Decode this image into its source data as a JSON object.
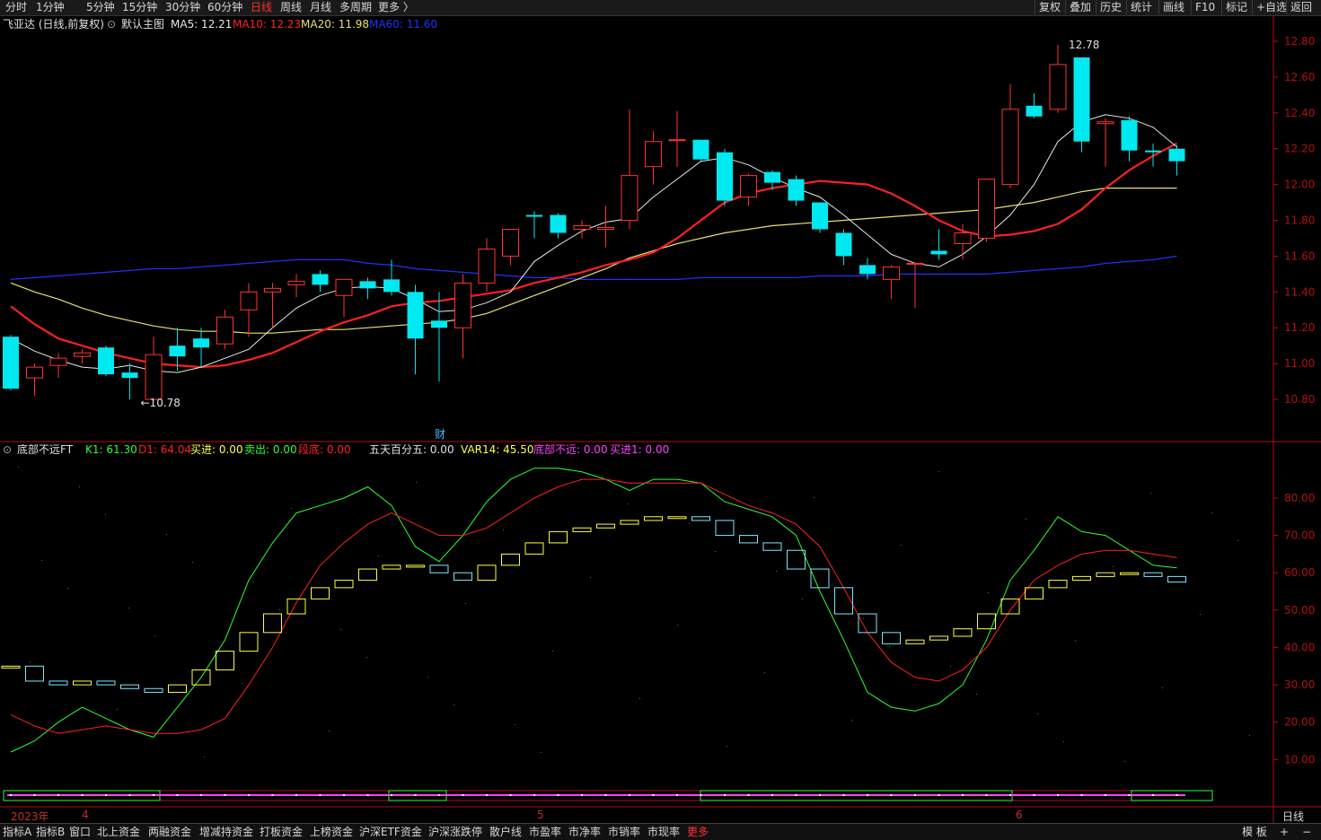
{
  "topbar": {
    "periods": [
      "分时",
      "1分钟",
      "5分钟",
      "15分钟",
      "30分钟",
      "60分钟",
      "日线",
      "周线",
      "月线",
      "多周期",
      "更多 〉"
    ],
    "active_period": "日线",
    "right_buttons": [
      "复权",
      "叠加",
      "历史",
      "统计",
      "画线",
      "F10",
      "标记",
      "+自选",
      "返回"
    ]
  },
  "main_legend": {
    "stock": "飞亚达 (日线,前复权)",
    "template": "默认主图",
    "ma5": "MA5: 12.21",
    "ma10": "MA10: 12.23",
    "ma20": "MA20: 11.98",
    "ma60": "MA60: 11.60"
  },
  "sub_legend": {
    "name": "底部不远FT",
    "k1": "K1: 61.30",
    "d1": "D1: 64.04",
    "buy": "买进: 0.00",
    "sell": "卖出: 0.00",
    "bottom": "段底: 0.00",
    "five_day": "五天百分五: 0.00",
    "var14": "VAR14: 45.50",
    "bottom_near": "底部不远: 0.00",
    "buy1": "买进1: 0.00"
  },
  "colors": {
    "up": "#ff3333",
    "down": "#00e8f0",
    "ma5": "#e8e8e8",
    "ma10": "#ff2020",
    "ma20": "#e8e070",
    "ma60": "#2030ff",
    "k1": "#30ff30",
    "d1": "#ff2020",
    "yellow": "#ffff40",
    "magenta": "#ff40ff",
    "axis": "#b01010"
  },
  "price_axis": {
    "labels": [
      "12.80",
      "12.60",
      "12.40",
      "12.20",
      "12.00",
      "11.80",
      "11.60",
      "11.40",
      "11.20",
      "11.00",
      "10.80"
    ]
  },
  "indicator_axis": {
    "labels": [
      "80.00",
      "70.00",
      "60.00",
      "50.00",
      "40.00",
      "30.00",
      "20.00",
      "10.00"
    ]
  },
  "annotations": {
    "high": "12.78",
    "low": "10.78",
    "marker": "财"
  },
  "dates": {
    "year_label": "2023年",
    "month4": "4",
    "month5": "5",
    "month6": "6",
    "period": "日线"
  },
  "chart_data": {
    "type": "candlestick",
    "ylim": [
      10.7,
      12.85
    ],
    "candles": [
      {
        "o": 11.15,
        "h": 11.16,
        "l": 10.85,
        "c": 10.86
      },
      {
        "o": 10.92,
        "h": 11.0,
        "l": 10.82,
        "c": 10.98
      },
      {
        "o": 10.99,
        "h": 11.06,
        "l": 10.92,
        "c": 11.03
      },
      {
        "o": 11.04,
        "h": 11.08,
        "l": 11.0,
        "c": 11.06
      },
      {
        "o": 11.09,
        "h": 11.1,
        "l": 10.93,
        "c": 10.94
      },
      {
        "o": 10.95,
        "h": 11.0,
        "l": 10.8,
        "c": 10.92
      },
      {
        "o": 10.8,
        "h": 11.15,
        "l": 10.79,
        "c": 11.05
      },
      {
        "o": 11.1,
        "h": 11.2,
        "l": 10.96,
        "c": 11.04
      },
      {
        "o": 11.14,
        "h": 11.2,
        "l": 10.98,
        "c": 11.09
      },
      {
        "o": 11.11,
        "h": 11.3,
        "l": 11.08,
        "c": 11.26
      },
      {
        "o": 11.3,
        "h": 11.45,
        "l": 11.15,
        "c": 11.4
      },
      {
        "o": 11.4,
        "h": 11.45,
        "l": 11.2,
        "c": 11.42
      },
      {
        "o": 11.44,
        "h": 11.5,
        "l": 11.37,
        "c": 11.46
      },
      {
        "o": 11.5,
        "h": 11.52,
        "l": 11.4,
        "c": 11.44
      },
      {
        "o": 11.38,
        "h": 11.47,
        "l": 11.26,
        "c": 11.47
      },
      {
        "o": 11.46,
        "h": 11.48,
        "l": 11.36,
        "c": 11.42
      },
      {
        "o": 11.47,
        "h": 11.58,
        "l": 11.38,
        "c": 11.4
      },
      {
        "o": 11.4,
        "h": 11.44,
        "l": 10.94,
        "c": 11.14
      },
      {
        "o": 11.24,
        "h": 11.4,
        "l": 10.9,
        "c": 11.2
      },
      {
        "o": 11.2,
        "h": 11.5,
        "l": 11.03,
        "c": 11.45
      },
      {
        "o": 11.45,
        "h": 11.7,
        "l": 11.4,
        "c": 11.64
      },
      {
        "o": 11.6,
        "h": 11.75,
        "l": 11.55,
        "c": 11.75
      },
      {
        "o": 11.83,
        "h": 11.85,
        "l": 11.7,
        "c": 11.82
      },
      {
        "o": 11.83,
        "h": 11.84,
        "l": 11.7,
        "c": 11.73
      },
      {
        "o": 11.75,
        "h": 11.8,
        "l": 11.7,
        "c": 11.77
      },
      {
        "o": 11.75,
        "h": 11.88,
        "l": 11.65,
        "c": 11.76
      },
      {
        "o": 11.8,
        "h": 12.42,
        "l": 11.75,
        "c": 12.05
      },
      {
        "o": 12.1,
        "h": 12.3,
        "l": 12.0,
        "c": 12.24
      },
      {
        "o": 12.25,
        "h": 12.41,
        "l": 12.1,
        "c": 12.25
      },
      {
        "o": 12.25,
        "h": 12.25,
        "l": 12.13,
        "c": 12.14
      },
      {
        "o": 12.18,
        "h": 12.2,
        "l": 11.88,
        "c": 11.91
      },
      {
        "o": 11.93,
        "h": 12.06,
        "l": 11.88,
        "c": 12.05
      },
      {
        "o": 12.07,
        "h": 12.08,
        "l": 11.97,
        "c": 12.01
      },
      {
        "o": 12.03,
        "h": 12.05,
        "l": 11.88,
        "c": 11.91
      },
      {
        "o": 11.9,
        "h": 11.9,
        "l": 11.73,
        "c": 11.75
      },
      {
        "o": 11.73,
        "h": 11.75,
        "l": 11.55,
        "c": 11.6
      },
      {
        "o": 11.55,
        "h": 11.59,
        "l": 11.47,
        "c": 11.5
      },
      {
        "o": 11.47,
        "h": 11.55,
        "l": 11.36,
        "c": 11.54
      },
      {
        "o": 11.56,
        "h": 11.56,
        "l": 11.31,
        "c": 11.56
      },
      {
        "o": 11.63,
        "h": 11.75,
        "l": 11.58,
        "c": 11.61
      },
      {
        "o": 11.67,
        "h": 11.78,
        "l": 11.58,
        "c": 11.73
      },
      {
        "o": 11.7,
        "h": 11.97,
        "l": 11.68,
        "c": 12.03
      },
      {
        "o": 12.0,
        "h": 12.56,
        "l": 11.98,
        "c": 12.42
      },
      {
        "o": 12.44,
        "h": 12.51,
        "l": 12.37,
        "c": 12.38
      },
      {
        "o": 12.42,
        "h": 12.78,
        "l": 12.4,
        "c": 12.67
      },
      {
        "o": 12.71,
        "h": 12.71,
        "l": 12.18,
        "c": 12.24
      },
      {
        "o": 12.34,
        "h": 12.37,
        "l": 12.1,
        "c": 12.35
      },
      {
        "o": 12.36,
        "h": 12.38,
        "l": 12.13,
        "c": 12.19
      },
      {
        "o": 12.19,
        "h": 12.23,
        "l": 12.1,
        "c": 12.18
      },
      {
        "o": 12.2,
        "h": 12.22,
        "l": 12.05,
        "c": 12.13
      }
    ],
    "ma5": [
      11.14,
      11.07,
      11.02,
      10.98,
      10.97,
      10.99,
      10.96,
      10.95,
      10.98,
      11.03,
      11.08,
      11.2,
      11.31,
      11.38,
      11.42,
      11.43,
      11.42,
      11.36,
      11.29,
      11.3,
      11.34,
      11.4,
      11.57,
      11.66,
      11.74,
      11.79,
      11.81,
      11.93,
      12.03,
      12.13,
      12.15,
      12.11,
      12.04,
      11.98,
      11.93,
      11.83,
      11.72,
      11.61,
      11.56,
      11.54,
      11.61,
      11.71,
      11.83,
      12.0,
      12.24,
      12.35,
      12.39,
      12.37,
      12.32,
      12.21
    ],
    "ma10": [
      11.32,
      11.22,
      11.14,
      11.1,
      11.06,
      11.03,
      11.0,
      10.99,
      10.98,
      10.99,
      11.02,
      11.06,
      11.12,
      11.18,
      11.23,
      11.27,
      11.32,
      11.34,
      11.35,
      11.37,
      11.39,
      11.41,
      11.45,
      11.48,
      11.51,
      11.55,
      11.58,
      11.62,
      11.7,
      11.8,
      11.9,
      11.95,
      11.98,
      12.0,
      12.02,
      12.01,
      12.0,
      11.95,
      11.88,
      11.8,
      11.74,
      11.71,
      11.72,
      11.74,
      11.78,
      11.86,
      11.98,
      12.08,
      12.16,
      12.23
    ],
    "ma20": [
      11.45,
      11.4,
      11.36,
      11.31,
      11.27,
      11.24,
      11.21,
      11.19,
      11.18,
      11.18,
      11.17,
      11.17,
      11.18,
      11.19,
      11.19,
      11.2,
      11.21,
      11.22,
      11.23,
      11.25,
      11.28,
      11.33,
      11.38,
      11.43,
      11.48,
      11.53,
      11.59,
      11.63,
      11.67,
      11.7,
      11.73,
      11.75,
      11.77,
      11.78,
      11.79,
      11.8,
      11.81,
      11.82,
      11.83,
      11.84,
      11.85,
      11.86,
      11.88,
      11.9,
      11.93,
      11.96,
      11.98,
      11.98,
      11.98,
      11.98
    ],
    "ma60": [
      11.47,
      11.48,
      11.49,
      11.5,
      11.51,
      11.52,
      11.53,
      11.53,
      11.54,
      11.55,
      11.56,
      11.57,
      11.58,
      11.58,
      11.58,
      11.56,
      11.55,
      11.53,
      11.52,
      11.51,
      11.5,
      11.49,
      11.48,
      11.48,
      11.47,
      11.47,
      11.47,
      11.47,
      11.47,
      11.48,
      11.48,
      11.48,
      11.48,
      11.48,
      11.49,
      11.49,
      11.49,
      11.5,
      11.5,
      11.5,
      11.5,
      11.5,
      11.51,
      11.52,
      11.53,
      11.54,
      11.56,
      11.57,
      11.58,
      11.6
    ],
    "indicator": {
      "ylim": [
        0,
        92
      ],
      "k1": [
        12,
        15,
        20,
        24,
        21,
        18,
        16,
        24,
        32,
        42,
        58,
        68,
        76,
        78,
        80,
        83,
        78,
        67,
        63,
        70,
        79,
        85,
        88,
        88,
        87,
        85,
        82,
        85,
        85,
        84,
        79,
        77,
        75,
        70,
        55,
        42,
        28,
        24,
        23,
        25,
        30,
        42,
        58,
        66,
        75,
        71,
        70,
        66,
        62,
        61.3
      ],
      "d1": [
        22,
        19,
        17,
        18,
        19,
        18,
        17,
        17,
        18,
        21,
        30,
        40,
        52,
        62,
        68,
        73,
        76,
        73,
        70,
        70,
        72,
        76,
        80,
        83,
        85,
        85,
        84,
        84,
        84,
        84,
        81,
        78,
        76,
        73,
        67,
        56,
        44,
        36,
        32,
        31,
        34,
        40,
        50,
        58,
        62,
        65,
        66,
        66,
        65,
        64.04
      ],
      "var14": [
        35,
        31,
        30,
        31,
        30,
        29,
        28,
        30,
        34,
        39,
        44,
        49,
        53,
        56,
        58,
        61,
        62,
        62,
        60,
        58,
        62,
        65,
        68,
        71,
        72,
        73,
        74,
        75,
        75,
        74,
        70,
        68,
        66,
        61,
        56,
        49,
        44,
        41,
        42,
        43,
        45,
        49,
        53,
        56,
        58,
        59,
        60,
        60,
        59,
        57.5
      ]
    }
  }
}
